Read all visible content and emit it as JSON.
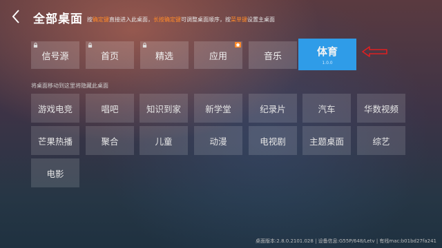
{
  "header": {
    "title": "全部桌面",
    "hint_parts": [
      "按",
      "确定键",
      "直接进入此桌面，",
      "长按确定键",
      "可调整桌面顺序，按",
      "菜单键",
      "设置主桌面"
    ],
    "back_icon": "back-chevron-icon"
  },
  "desktops": [
    {
      "label": "信号源",
      "locked": true
    },
    {
      "label": "首页",
      "locked": true
    },
    {
      "label": "精选",
      "locked": true
    },
    {
      "label": "应用",
      "badge": "home-badge-icon"
    },
    {
      "label": "音乐"
    },
    {
      "label": "体育",
      "version": "1.0.0",
      "focused": true
    }
  ],
  "hidden_section_label": "将桌面移动到这里将隐藏此桌面",
  "hidden_desktops": [
    "游戏电竞",
    "唱吧",
    "知识到家",
    "新学堂",
    "纪录片",
    "汽车",
    "华数视频",
    "芒果热播",
    "聚合",
    "儿童",
    "动漫",
    "电视剧",
    "主题桌面",
    "综艺",
    "电影"
  ],
  "footer": "桌面版本:2.8.0.2101.028 | 设备信息:G55P/648/Letv | 有线mac:b01bd27fa241",
  "colors": {
    "focus": "#2f9ce8",
    "highlight": "#ff8a2a",
    "arrow": "#e02020"
  }
}
